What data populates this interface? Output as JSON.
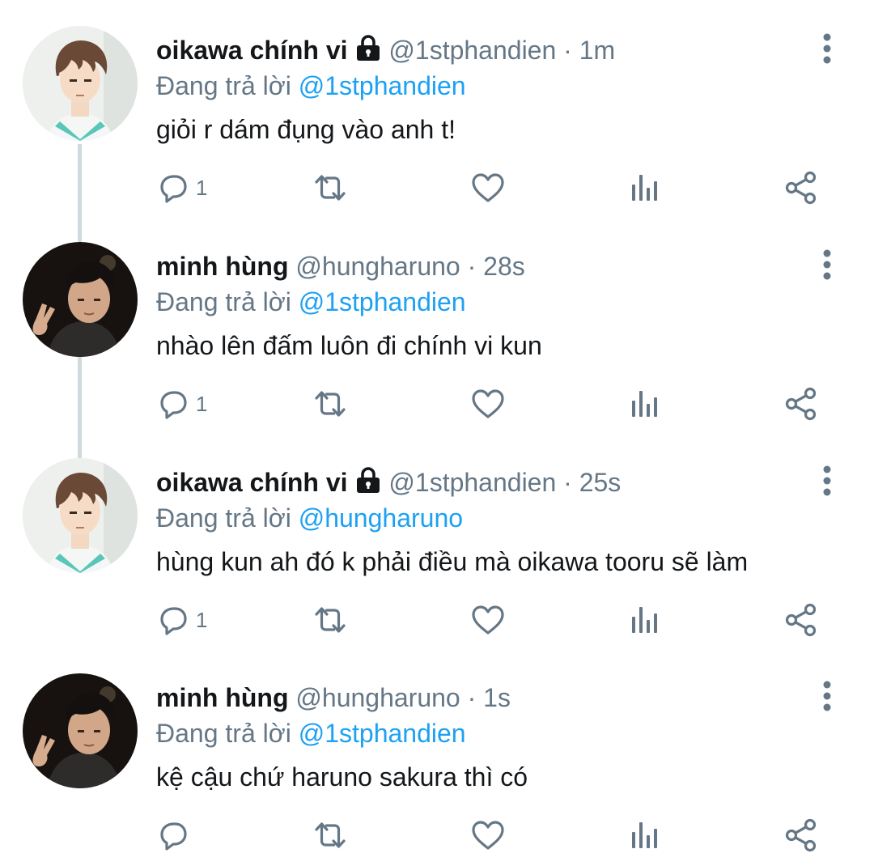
{
  "tweets": [
    {
      "author": "oikawa chính vi",
      "locked": true,
      "handle": "@1stphandien",
      "separator": "·",
      "time": "1m",
      "reply_prefix": "Đang trả lời",
      "reply_to": "@1stphandien",
      "text": "giỏi r dám đụng vào anh t!",
      "reply_count": "1",
      "avatar": "anime-character"
    },
    {
      "author": "minh hùng",
      "locked": false,
      "handle": "@hungharuno",
      "separator": "·",
      "time": "28s",
      "reply_prefix": "Đang trả lời",
      "reply_to": "@1stphandien",
      "text": "nhào lên đấm luôn đi chính vi kun",
      "reply_count": "1",
      "avatar": "person-peace-sign"
    },
    {
      "author": "oikawa chính vi",
      "locked": true,
      "handle": "@1stphandien",
      "separator": "·",
      "time": "25s",
      "reply_prefix": "Đang trả lời",
      "reply_to": "@hungharuno",
      "text": "hùng kun ah đó k phải điều mà oikawa tooru sẽ làm",
      "reply_count": "1",
      "avatar": "anime-character"
    },
    {
      "author": "minh hùng",
      "locked": false,
      "handle": "@hungharuno",
      "separator": "·",
      "time": "1s",
      "reply_prefix": "Đang trả lời",
      "reply_to": "@1stphandien",
      "text": "kệ cậu chứ haruno sakura thì có",
      "reply_count": "",
      "avatar": "person-peace-sign"
    }
  ],
  "icons": {
    "reply": "reply-icon",
    "retweet": "retweet-icon",
    "like": "heart-icon",
    "analytics": "analytics-icon",
    "share": "share-icon",
    "more": "more-icon",
    "lock": "lock-icon"
  },
  "colors": {
    "text": "#14171a",
    "muted": "#657786",
    "mention": "#1da1f2",
    "thread_line": "#cfd9de"
  }
}
